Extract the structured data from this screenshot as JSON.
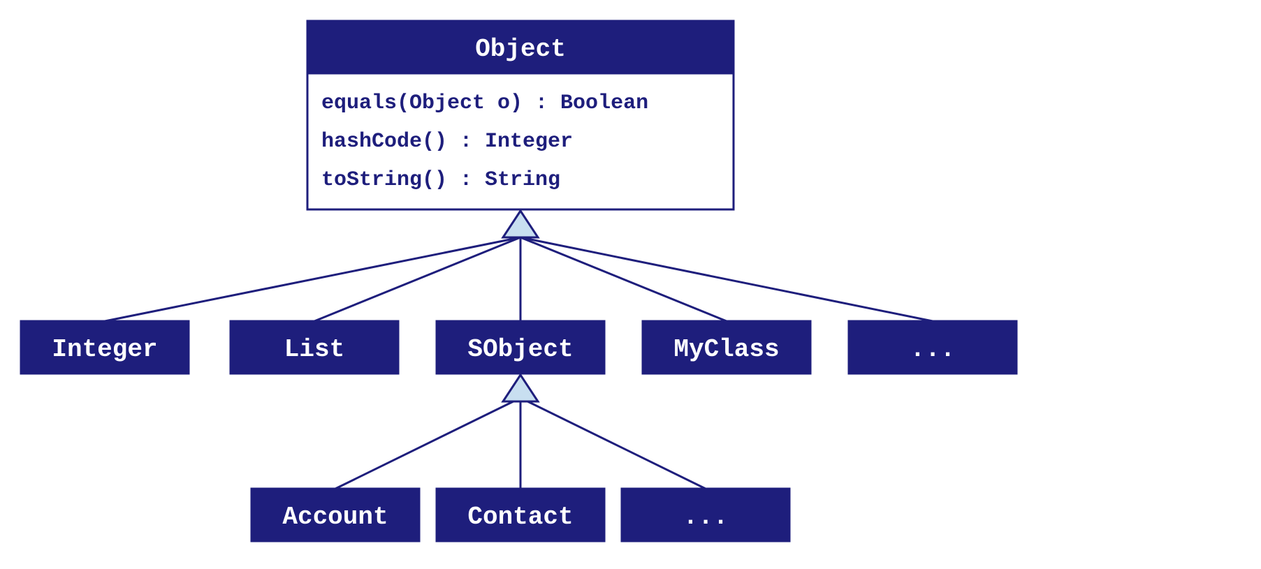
{
  "colors": {
    "darkNavy": "#1e1e7c",
    "lightBlue": "#c8dff0",
    "white": "#ffffff"
  },
  "root": {
    "name": "Object",
    "methods": [
      "equals(Object o) : Boolean",
      "hashCode() : Integer",
      "toString() : String"
    ]
  },
  "children": [
    {
      "label": "Integer"
    },
    {
      "label": "List"
    },
    {
      "label": "SObject"
    },
    {
      "label": "MyClass"
    },
    {
      "label": "..."
    }
  ],
  "grandchildren": [
    {
      "label": "Account"
    },
    {
      "label": "Contact"
    },
    {
      "label": "..."
    }
  ]
}
